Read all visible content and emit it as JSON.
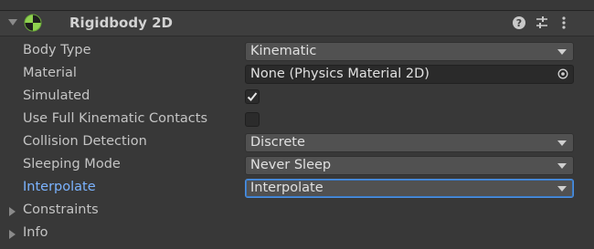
{
  "component": {
    "title": "Rigidbody 2D",
    "icon": "rigidbody-2d-icon",
    "header_buttons": [
      "help-icon",
      "preset-icon",
      "kebab-menu-icon"
    ]
  },
  "properties": {
    "body_type": {
      "label": "Body Type",
      "value": "Kinematic"
    },
    "material": {
      "label": "Material",
      "value": "None (Physics Material 2D)"
    },
    "simulated": {
      "label": "Simulated",
      "checked": true
    },
    "use_full_kinematic_contacts": {
      "label": "Use Full Kinematic Contacts",
      "checked": false
    },
    "collision_detection": {
      "label": "Collision Detection",
      "value": "Discrete"
    },
    "sleeping_mode": {
      "label": "Sleeping Mode",
      "value": "Never Sleep"
    },
    "interpolate": {
      "label": "Interpolate",
      "value": "Interpolate"
    }
  },
  "foldouts": {
    "constraints": {
      "label": "Constraints"
    },
    "info": {
      "label": "Info"
    }
  },
  "colors": {
    "background": "#383838",
    "header": "#3e3e3e",
    "highlight_label": "#7bb3ff",
    "focus_border": "#4d90e0"
  }
}
